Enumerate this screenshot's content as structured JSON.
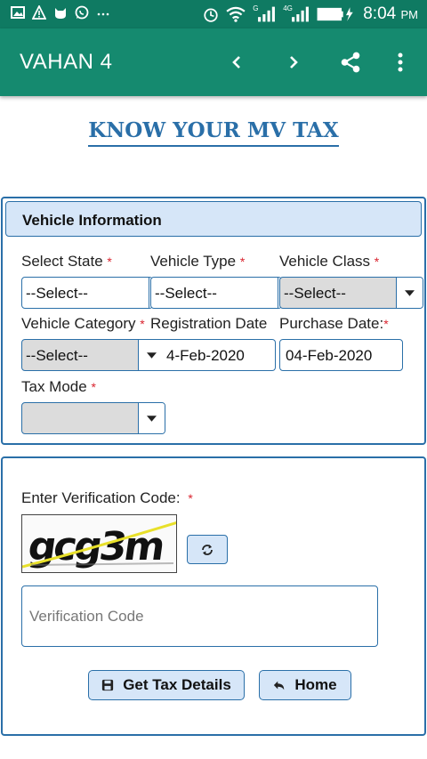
{
  "status_bar": {
    "left_icons": [
      "gallery-icon",
      "warning-icon",
      "cat-icon",
      "whatsapp-icon",
      "more-dots-icon"
    ],
    "right_icons": [
      "alarm-icon",
      "wifi-icon",
      "signal-icon",
      "signal-4g-icon",
      "battery-charging-icon"
    ],
    "time": "8:04",
    "ampm": "PM",
    "signal_1_label": "G",
    "signal_2_label": "4G"
  },
  "app_bar": {
    "title": "VAHAN 4",
    "icons": [
      "chevron-left-icon",
      "chevron-right-icon",
      "share-icon",
      "overflow-menu-icon"
    ]
  },
  "page": {
    "title": "KNOW YOUR MV TAX"
  },
  "vehicle_info": {
    "heading": "Vehicle Information",
    "fields": {
      "select_state": {
        "label": "Select State",
        "value": "--Select--"
      },
      "vehicle_type": {
        "label": "Vehicle Type",
        "value": "--Select--"
      },
      "vehicle_class": {
        "label": "Vehicle Class",
        "value": "--Select--"
      },
      "vehicle_category": {
        "label": "Vehicle Category",
        "value": "--Select--"
      },
      "registration_date": {
        "label": "Registration Date",
        "value": "4-Feb-2020"
      },
      "purchase_date": {
        "label": "Purchase Date:",
        "value": "04-Feb-2020"
      },
      "tax_mode": {
        "label": "Tax Mode",
        "value": ""
      }
    },
    "required_mark": "*"
  },
  "verification": {
    "label": "Enter Verification Code:",
    "required_mark": "*",
    "captcha_text": "gcg3m",
    "input_placeholder": "Verification Code"
  },
  "buttons": {
    "get_tax": "Get Tax Details",
    "home": "Home"
  },
  "colors": {
    "status_bar": "#0f7a62",
    "app_bar": "#158a6f",
    "accent": "#2a6fa8",
    "panel_heading_bg": "#d6e6f8",
    "required": "#d9232e"
  }
}
